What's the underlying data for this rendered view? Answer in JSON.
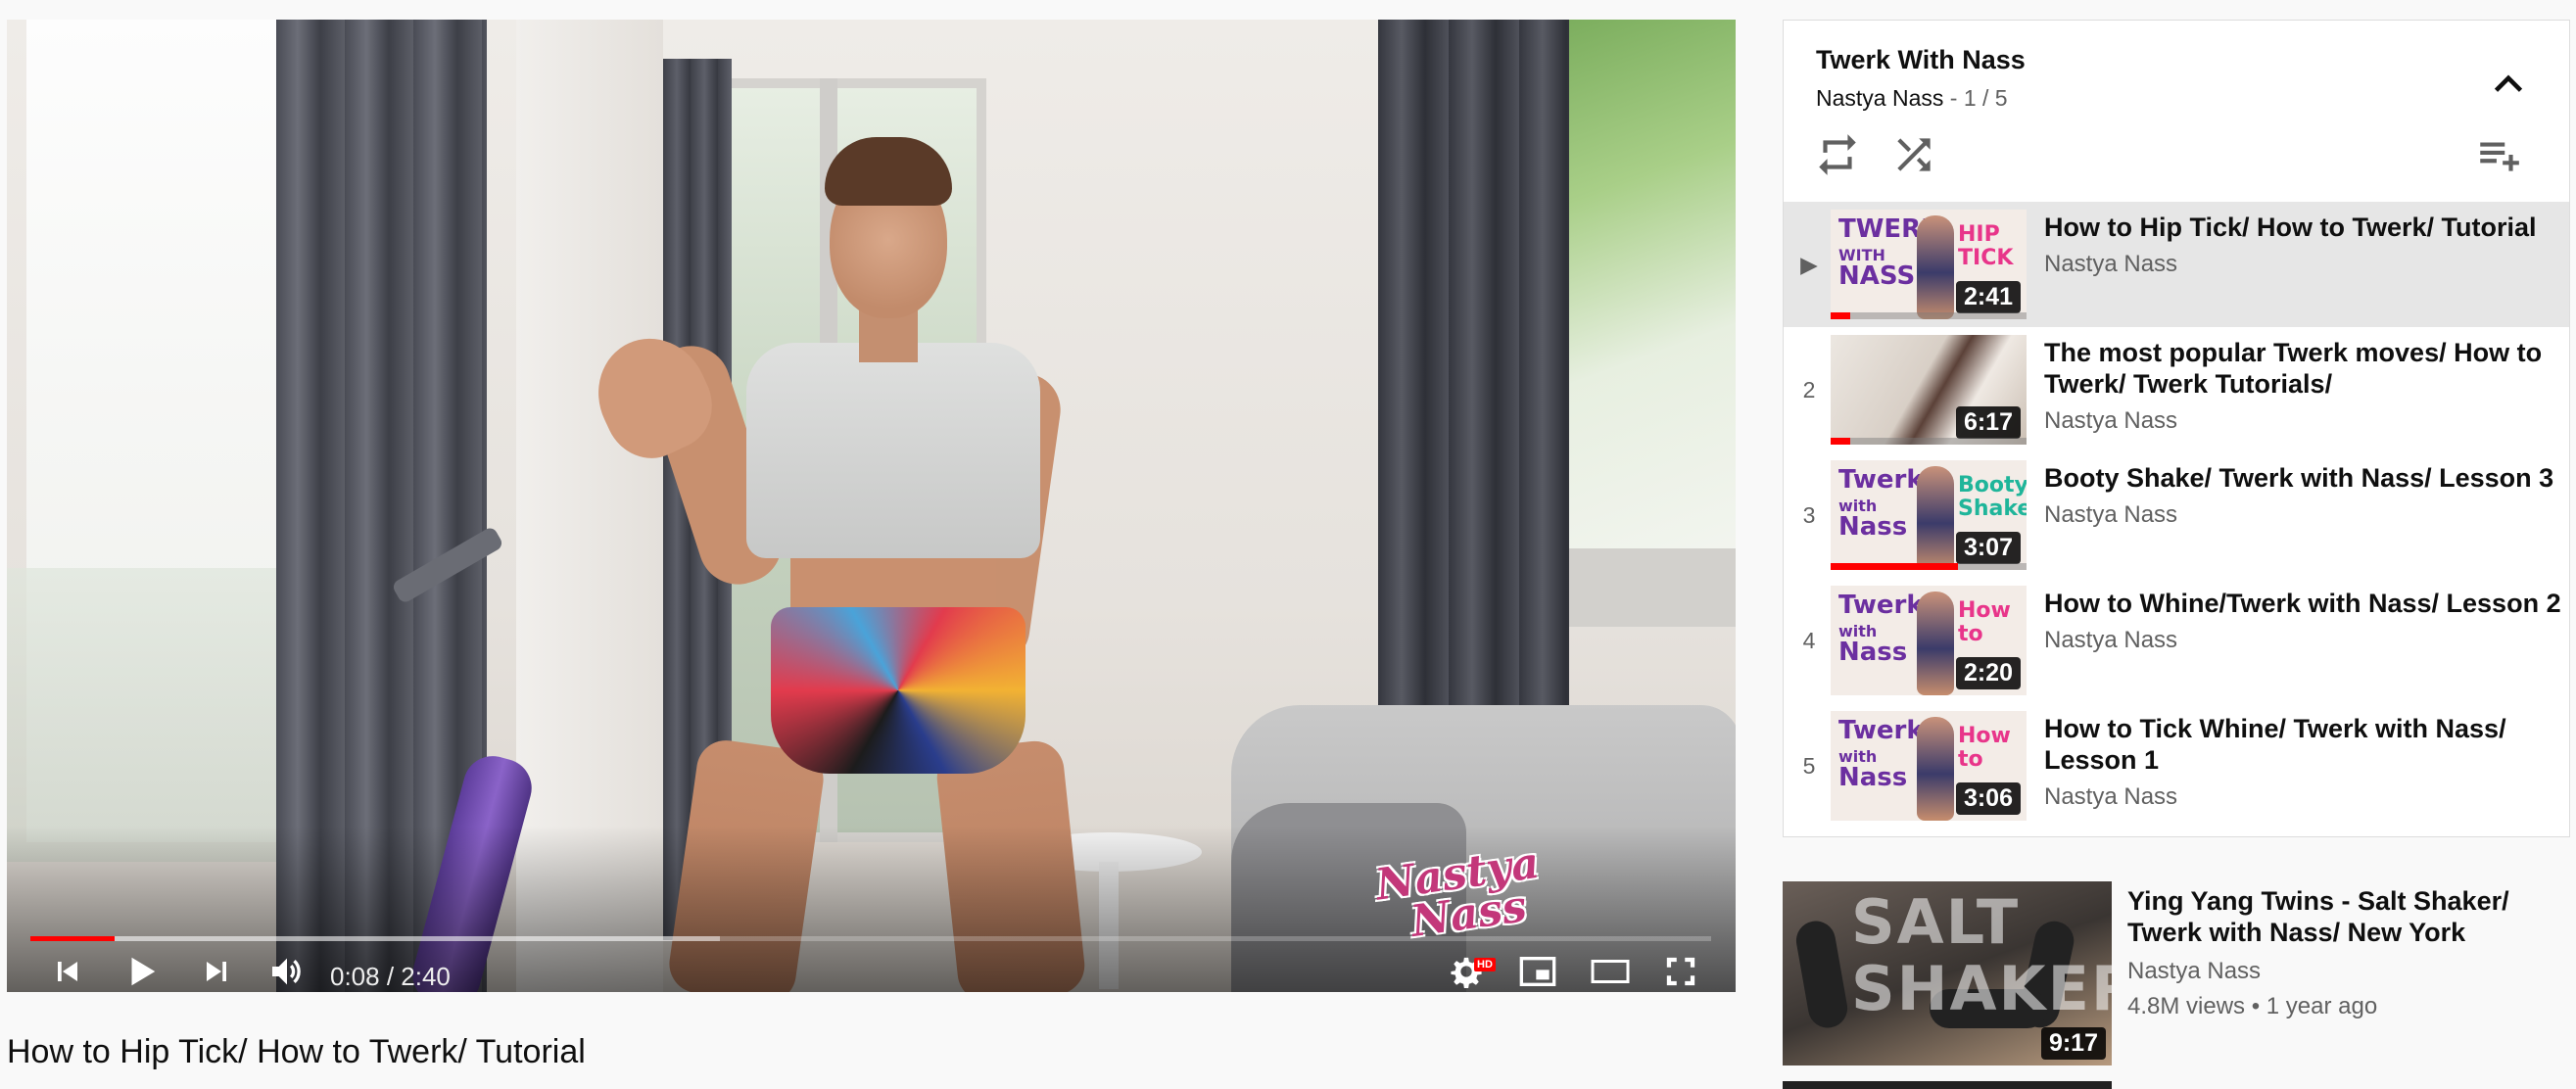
{
  "player": {
    "time_current": "0:08",
    "time_total": "2:40",
    "time_display": "0:08 / 2:40",
    "progress_played": 0.05,
    "progress_loaded": 0.41,
    "hd_badge": "HD",
    "watermark": "Nastya Nass",
    "accent_color": "#ff0000"
  },
  "video": {
    "title": "How to Hip Tick/ How to Twerk/ Tutorial"
  },
  "playlist": {
    "title": "Twerk With Nass",
    "channel": "Nastya Nass",
    "position": "1 / 5",
    "separator": "-",
    "items": [
      {
        "index": "▶",
        "title": "How to Hip Tick/ How to Twerk/ Tutorial",
        "channel": "Nastya Nass",
        "duration": "2:41",
        "thumb_left": "TWERK\nWITH\nNASS",
        "thumb_right": "HIP\nTICK",
        "thumb_right_color": "#e8358a",
        "watched": 0.1
      },
      {
        "index": "2",
        "title": "The most popular Twerk moves/ How to Twerk/ Twerk Tutorials/",
        "channel": "Nastya Nass",
        "duration": "6:17",
        "thumb_left": "",
        "thumb_right": "",
        "thumb_right_color": "#e8358a",
        "watched": 0.1
      },
      {
        "index": "3",
        "title": "Booty Shake/ Twerk with Nass/ Lesson 3",
        "channel": "Nastya Nass",
        "duration": "3:07",
        "thumb_left": "Twerk\nwith\nNass",
        "thumb_right": "Booty\nShake",
        "thumb_right_color": "#1fb59a",
        "watched": 0.65
      },
      {
        "index": "4",
        "title": "How to Whine/Twerk with Nass/ Lesson 2",
        "channel": "Nastya Nass",
        "duration": "2:20",
        "thumb_left": "Twerk\nwith\nNass",
        "thumb_right": "How\nto",
        "thumb_right_color": "#e8358a",
        "watched": 0
      },
      {
        "index": "5",
        "title": "How to Tick Whine/ Twerk with Nass/ Lesson 1",
        "channel": "Nastya Nass",
        "duration": "3:06",
        "thumb_left": "Twerk\nwith\nNass",
        "thumb_right": "How\nto",
        "thumb_right_color": "#e8358a",
        "watched": 0
      }
    ]
  },
  "recommended": [
    {
      "title": "Ying Yang Twins - Salt Shaker/ Twerk with Nass/ New York",
      "channel": "Nastya Nass",
      "views": "4.8M views",
      "age": "1 year ago",
      "meta": "4.8M views • 1 year ago",
      "duration": "9:17",
      "thumb_text": "SALT\nSHAKER"
    }
  ],
  "icons": {
    "player": [
      "previous-icon",
      "play-icon",
      "next-icon",
      "volume-icon",
      "settings-icon",
      "miniplayer-icon",
      "theater-icon",
      "fullscreen-icon"
    ],
    "playlist": [
      "chevron-up-icon",
      "loop-icon",
      "shuffle-icon",
      "playlist-add-icon"
    ]
  }
}
